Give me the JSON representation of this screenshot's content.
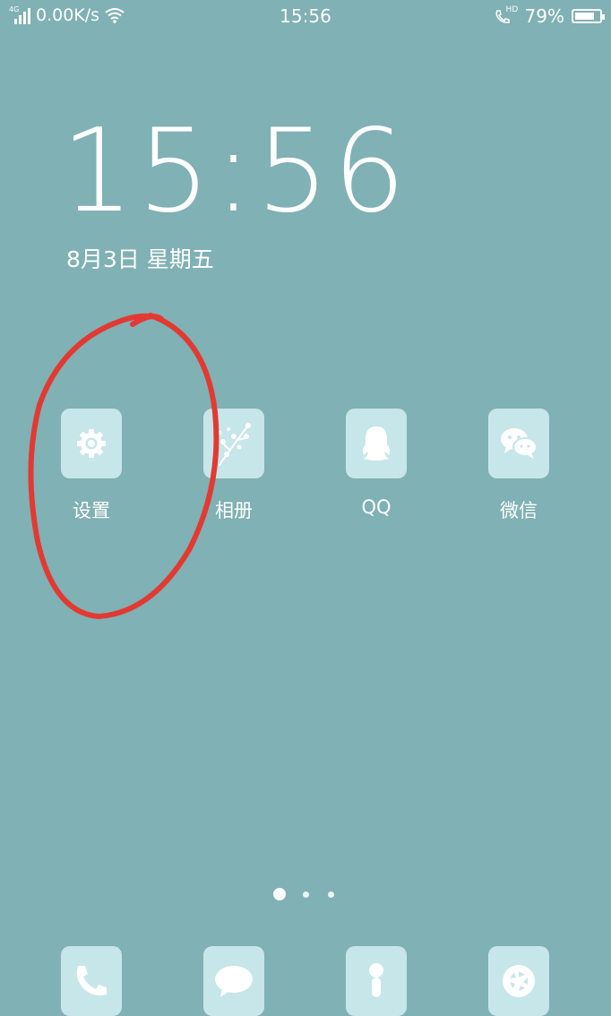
{
  "status_bar": {
    "network_type": "4G",
    "speed": "0.00K/s",
    "time": "15:56",
    "hd_badge": "HD",
    "battery_percent": "79%",
    "battery_level": 0.79
  },
  "lock_clock": {
    "time": "15:56",
    "date": "8月3日  星期五"
  },
  "apps": [
    {
      "label": "设置",
      "icon": "gear-icon"
    },
    {
      "label": "相册",
      "icon": "gallery-icon"
    },
    {
      "label": "QQ",
      "icon": "qq-penguin-icon"
    },
    {
      "label": "微信",
      "icon": "wechat-icon"
    }
  ],
  "dock": [
    {
      "icon": "phone-icon"
    },
    {
      "icon": "message-icon"
    },
    {
      "icon": "contacts-icon"
    },
    {
      "icon": "camera-icon"
    }
  ],
  "page_indicator": {
    "pages": 3,
    "current": 1
  },
  "colors": {
    "wallpaper": "#80b1b4",
    "tile": "#c7e6ea",
    "glyph": "#ffffff",
    "annotation": "#e23a32"
  }
}
